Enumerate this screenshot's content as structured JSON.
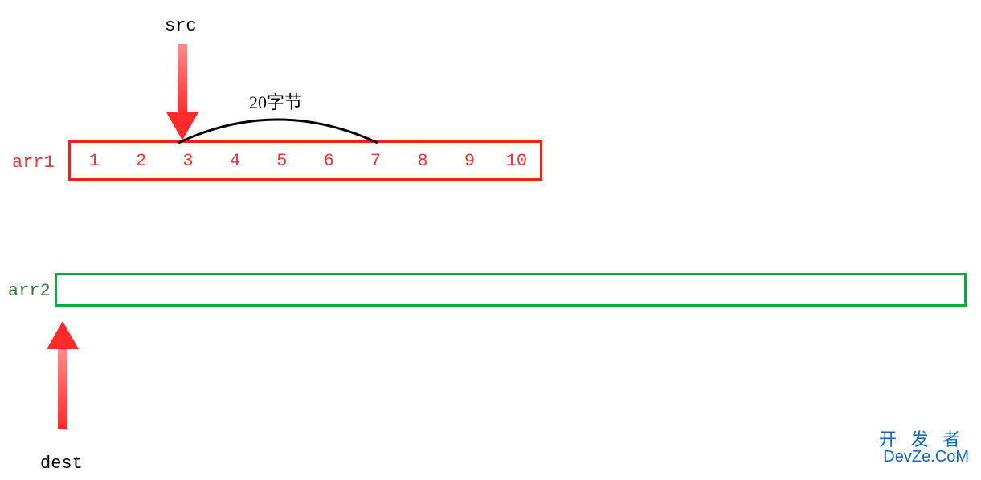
{
  "labels": {
    "src": "src",
    "bytes": "20字节",
    "arr1": "arr1",
    "arr2": "arr2",
    "dest": "dest"
  },
  "arr1_values": [
    "1",
    "2",
    "3",
    "4",
    "5",
    "6",
    "7",
    "8",
    "9",
    "10"
  ],
  "watermark": {
    "line1": "开 发 者",
    "line2": "DevZe.CoM"
  },
  "chart_data": {
    "type": "diagram",
    "title": "memcpy src/dest illustration",
    "arrays": [
      {
        "name": "arr1",
        "values": [
          1,
          2,
          3,
          4,
          5,
          6,
          7,
          8,
          9,
          10
        ],
        "color": "#ff1a1a"
      },
      {
        "name": "arr2",
        "values": [],
        "color": "#0aa845"
      }
    ],
    "pointers": [
      {
        "name": "src",
        "points_to": "arr1",
        "index": 2,
        "value": 3
      },
      {
        "name": "dest",
        "points_to": "arr2",
        "index": 0
      }
    ],
    "span": {
      "from_index": 2,
      "to_index": 6,
      "bytes": 20,
      "label": "20字节"
    }
  }
}
